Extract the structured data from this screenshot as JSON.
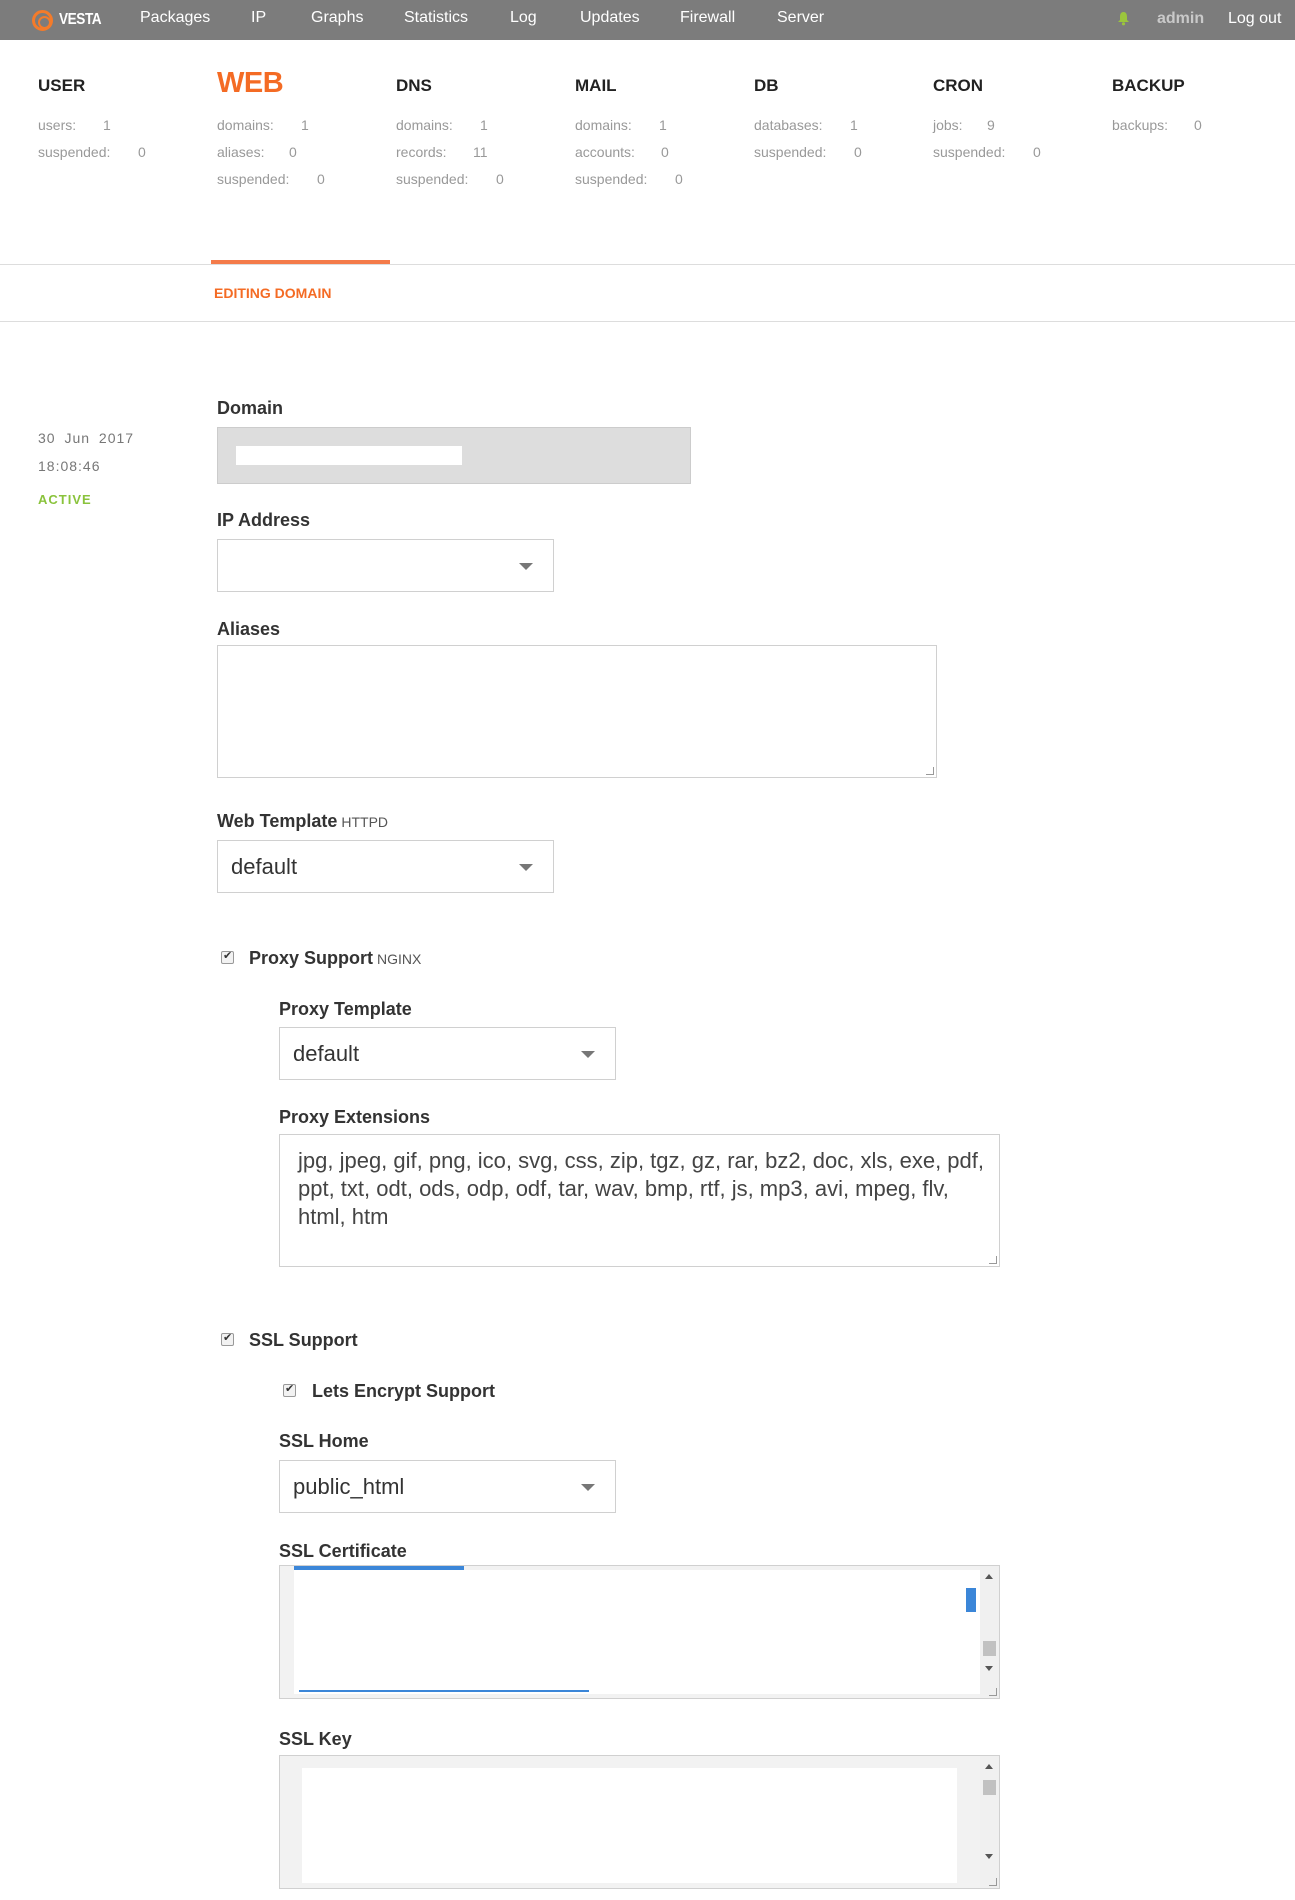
{
  "nav": {
    "logo": "VESTA",
    "items": [
      "Packages",
      "IP",
      "Graphs",
      "Statistics",
      "Log",
      "Updates",
      "Firewall",
      "Server"
    ],
    "user": "admin",
    "logout": "Log out"
  },
  "stats": [
    {
      "title": "USER",
      "rows": [
        [
          "users:",
          "1"
        ],
        [
          "suspended:",
          "0"
        ]
      ]
    },
    {
      "title": "WEB",
      "rows": [
        [
          "domains:",
          "1"
        ],
        [
          "aliases:",
          "0"
        ],
        [
          "suspended:",
          "0"
        ]
      ]
    },
    {
      "title": "DNS",
      "rows": [
        [
          "domains:",
          "1"
        ],
        [
          "records:",
          "11"
        ],
        [
          "suspended:",
          "0"
        ]
      ]
    },
    {
      "title": "MAIL",
      "rows": [
        [
          "domains:",
          "1"
        ],
        [
          "accounts:",
          "0"
        ],
        [
          "suspended:",
          "0"
        ]
      ]
    },
    {
      "title": "DB",
      "rows": [
        [
          "databases:",
          "1"
        ],
        [
          "suspended:",
          "0"
        ]
      ]
    },
    {
      "title": "CRON",
      "rows": [
        [
          "jobs:",
          "9"
        ],
        [
          "suspended:",
          "0"
        ]
      ]
    },
    {
      "title": "BACKUP",
      "rows": [
        [
          "backups:",
          "0"
        ]
      ]
    }
  ],
  "page": {
    "title": "EDITING DOMAIN",
    "date": "30 Jun 2017",
    "time": "18:08:46",
    "status": "ACTIVE"
  },
  "form": {
    "domain_label": "Domain",
    "ip_label": "IP Address",
    "ip_value": "",
    "aliases_label": "Aliases",
    "aliases_value": "",
    "web_template_label": "Web Template",
    "web_template_sub": "HTTPD",
    "web_template_value": "default",
    "proxy_support_label": "Proxy Support",
    "proxy_support_sub": "NGINX",
    "proxy_template_label": "Proxy Template",
    "proxy_template_value": "default",
    "proxy_ext_label": "Proxy Extensions",
    "proxy_ext_value": "jpg, jpeg, gif, png, ico, svg, css, zip, tgz, gz, rar, bz2, doc, xls, exe, pdf, ppt, txt, odt, ods, odp, odf, tar, wav, bmp, rtf, js, mp3, avi, mpeg, flv, html, htm",
    "ssl_support_label": "SSL Support",
    "letsencrypt_label": "Lets Encrypt Support",
    "ssl_home_label": "SSL Home",
    "ssl_home_value": "public_html",
    "ssl_cert_label": "SSL Certificate",
    "ssl_key_label": "SSL Key"
  }
}
